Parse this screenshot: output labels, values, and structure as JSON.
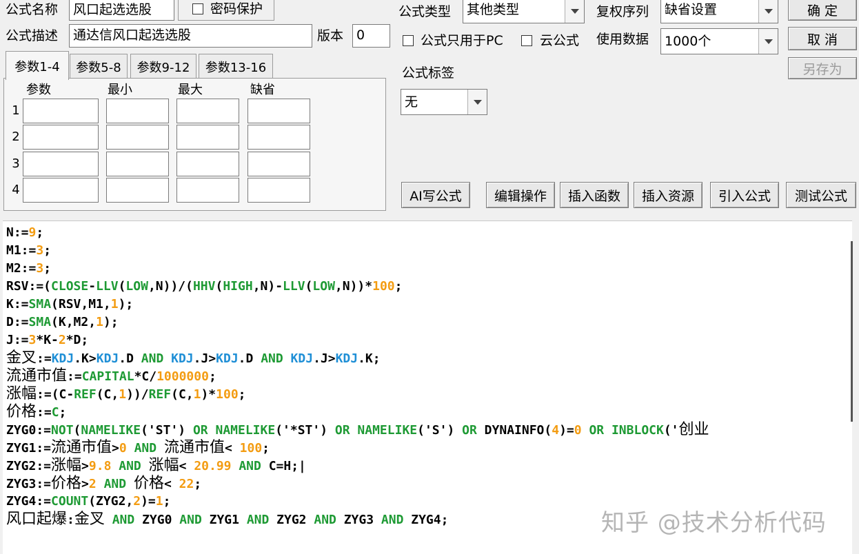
{
  "formula": {
    "name_label": "公式名称",
    "name_value": "风口起选选股",
    "password_label": "密码保护",
    "desc_label": "公式描述",
    "desc_value": "通达信风口起选选股",
    "version_label": "版本",
    "version_value": "0"
  },
  "type": {
    "type_label": "公式类型",
    "type_value": "其他类型",
    "adjust_label": "复权序列",
    "adjust_value": "缺省设置",
    "pc_only_label": "公式只用于PC",
    "cloud_label": "云公式",
    "data_label": "使用数据",
    "data_value": "1000个",
    "tag_label": "公式标签",
    "tag_value": "无"
  },
  "buttons": {
    "ok": "确 定",
    "cancel": "取 消",
    "save_as": "另存为",
    "ai_write": "AI写公式",
    "edit_ops": "编辑操作",
    "insert_func": "插入函数",
    "insert_res": "插入资源",
    "import_formula": "引入公式",
    "test_formula": "测试公式"
  },
  "params": {
    "tabs": [
      "参数1-4",
      "参数5-8",
      "参数9-12",
      "参数13-16"
    ],
    "headers": [
      "参数",
      "最小",
      "最大",
      "缺省"
    ],
    "rows": [
      "1",
      "2",
      "3",
      "4"
    ]
  },
  "code": {
    "lines": [
      [
        [
          "N:=",
          "k"
        ],
        [
          "9",
          "o"
        ],
        [
          ";",
          "k"
        ]
      ],
      [
        [
          "M1:=",
          "k"
        ],
        [
          "3",
          "o"
        ],
        [
          ";",
          "k"
        ]
      ],
      [
        [
          "M2:=",
          "k"
        ],
        [
          "3",
          "o"
        ],
        [
          ";",
          "k"
        ]
      ],
      [
        [
          "RSV:=(",
          "k"
        ],
        [
          "CLOSE",
          "g"
        ],
        [
          "-",
          "k"
        ],
        [
          "LLV",
          "g"
        ],
        [
          "(",
          "k"
        ],
        [
          "LOW",
          "g"
        ],
        [
          ",N))/(",
          "k"
        ],
        [
          "HHV",
          "g"
        ],
        [
          "(",
          "k"
        ],
        [
          "HIGH",
          "g"
        ],
        [
          ",N)-",
          "k"
        ],
        [
          "LLV",
          "g"
        ],
        [
          "(",
          "k"
        ],
        [
          "LOW",
          "g"
        ],
        [
          ",N))*",
          "k"
        ],
        [
          "100",
          "o"
        ],
        [
          ";",
          "k"
        ]
      ],
      [
        [
          "K:=",
          "k"
        ],
        [
          "SMA",
          "g"
        ],
        [
          "(RSV,M1,",
          "k"
        ],
        [
          "1",
          "o"
        ],
        [
          ");",
          "k"
        ]
      ],
      [
        [
          "D:=",
          "k"
        ],
        [
          "SMA",
          "g"
        ],
        [
          "(K,M2,",
          "k"
        ],
        [
          "1",
          "o"
        ],
        [
          ");",
          "k"
        ]
      ],
      [
        [
          "J:=",
          "k"
        ],
        [
          "3",
          "o"
        ],
        [
          "*K-",
          "k"
        ],
        [
          "2",
          "o"
        ],
        [
          "*D;",
          "k"
        ]
      ],
      [
        [
          "金叉",
          "c"
        ],
        [
          ":=",
          "k"
        ],
        [
          "KDJ",
          "b"
        ],
        [
          ".K>",
          "k"
        ],
        [
          "KDJ",
          "b"
        ],
        [
          ".D ",
          "k"
        ],
        [
          "AND",
          "g"
        ],
        [
          " ",
          "k"
        ],
        [
          "KDJ",
          "b"
        ],
        [
          ".J>",
          "k"
        ],
        [
          "KDJ",
          "b"
        ],
        [
          ".D ",
          "k"
        ],
        [
          "AND",
          "g"
        ],
        [
          " ",
          "k"
        ],
        [
          "KDJ",
          "b"
        ],
        [
          ".J>",
          "k"
        ],
        [
          "KDJ",
          "b"
        ],
        [
          ".K;",
          "k"
        ]
      ],
      [
        [
          "流通市值",
          "c"
        ],
        [
          ":=",
          "k"
        ],
        [
          "CAPITAL",
          "g"
        ],
        [
          "*C/",
          "k"
        ],
        [
          "1000000",
          "o"
        ],
        [
          ";",
          "k"
        ]
      ],
      [
        [
          "涨幅",
          "c"
        ],
        [
          ":=(C-",
          "k"
        ],
        [
          "REF",
          "g"
        ],
        [
          "(C,",
          "k"
        ],
        [
          "1",
          "o"
        ],
        [
          "))/",
          "k"
        ],
        [
          "REF",
          "g"
        ],
        [
          "(C,",
          "k"
        ],
        [
          "1",
          "o"
        ],
        [
          ")*",
          "k"
        ],
        [
          "100",
          "o"
        ],
        [
          ";",
          "k"
        ]
      ],
      [
        [
          "价格",
          "c"
        ],
        [
          ":=",
          "k"
        ],
        [
          "C",
          "g"
        ],
        [
          ";",
          "k"
        ]
      ],
      [
        [
          "ZYG0:=",
          "k"
        ],
        [
          "NOT",
          "g"
        ],
        [
          "(",
          "k"
        ],
        [
          "NAMELIKE",
          "g"
        ],
        [
          "('ST') ",
          "k"
        ],
        [
          "OR",
          "g"
        ],
        [
          " ",
          "k"
        ],
        [
          "NAMELIKE",
          "g"
        ],
        [
          "('*ST') ",
          "k"
        ],
        [
          "OR",
          "g"
        ],
        [
          " ",
          "k"
        ],
        [
          "NAMELIKE",
          "g"
        ],
        [
          "('S') ",
          "k"
        ],
        [
          "OR",
          "g"
        ],
        [
          " DYNAINFO(",
          "k"
        ],
        [
          "4",
          "o"
        ],
        [
          ")=",
          "k"
        ],
        [
          "0",
          "o"
        ],
        [
          " ",
          "k"
        ],
        [
          "OR",
          "g"
        ],
        [
          " ",
          "k"
        ],
        [
          "INBLOCK",
          "g"
        ],
        [
          "('",
          "k"
        ],
        [
          "创业",
          "c"
        ]
      ],
      [
        [
          "ZYG1:=",
          "k"
        ],
        [
          "流通市值",
          "c"
        ],
        [
          ">",
          "k"
        ],
        [
          "0",
          "o"
        ],
        [
          " ",
          "k"
        ],
        [
          "AND",
          "g"
        ],
        [
          " ",
          "k"
        ],
        [
          "流通市值",
          "c"
        ],
        [
          "< ",
          "k"
        ],
        [
          "100",
          "o"
        ],
        [
          ";",
          "k"
        ]
      ],
      [
        [
          "ZYG2:=",
          "k"
        ],
        [
          "涨幅",
          "c"
        ],
        [
          ">",
          "k"
        ],
        [
          "9.8",
          "o"
        ],
        [
          " ",
          "k"
        ],
        [
          "AND",
          "g"
        ],
        [
          " ",
          "k"
        ],
        [
          "涨幅",
          "c"
        ],
        [
          "< ",
          "k"
        ],
        [
          "20.99",
          "o"
        ],
        [
          " ",
          "k"
        ],
        [
          "AND",
          "g"
        ],
        [
          " C=H;",
          "k"
        ],
        [
          "|",
          "k"
        ]
      ],
      [
        [
          "ZYG3:=",
          "k"
        ],
        [
          "价格",
          "c"
        ],
        [
          ">",
          "k"
        ],
        [
          "2",
          "o"
        ],
        [
          " ",
          "k"
        ],
        [
          "AND",
          "g"
        ],
        [
          " ",
          "k"
        ],
        [
          "价格",
          "c"
        ],
        [
          "< ",
          "k"
        ],
        [
          "22",
          "o"
        ],
        [
          ";",
          "k"
        ]
      ],
      [
        [
          "ZYG4:=",
          "k"
        ],
        [
          "COUNT",
          "g"
        ],
        [
          "(ZYG2,",
          "k"
        ],
        [
          "2",
          "o"
        ],
        [
          ")=",
          "k"
        ],
        [
          "1",
          "o"
        ],
        [
          ";",
          "k"
        ]
      ],
      [
        [
          "风口起爆",
          "c"
        ],
        [
          ":",
          "k"
        ],
        [
          "金叉",
          "c"
        ],
        [
          " ",
          "k"
        ],
        [
          "AND",
          "g"
        ],
        [
          " ZYG0 ",
          "k"
        ],
        [
          "AND",
          "g"
        ],
        [
          " ZYG1 ",
          "k"
        ],
        [
          "AND",
          "g"
        ],
        [
          " ZYG2 ",
          "k"
        ],
        [
          "AND",
          "g"
        ],
        [
          " ZYG3 ",
          "k"
        ],
        [
          "AND",
          "g"
        ],
        [
          " ZYG4;",
          "k"
        ]
      ]
    ]
  },
  "colors": {
    "k": "#000000",
    "o": "#f39c12",
    "g": "#1e9a34",
    "b": "#1f8fd6",
    "c": "#000000"
  },
  "watermark": "知乎 @技术分析代码"
}
